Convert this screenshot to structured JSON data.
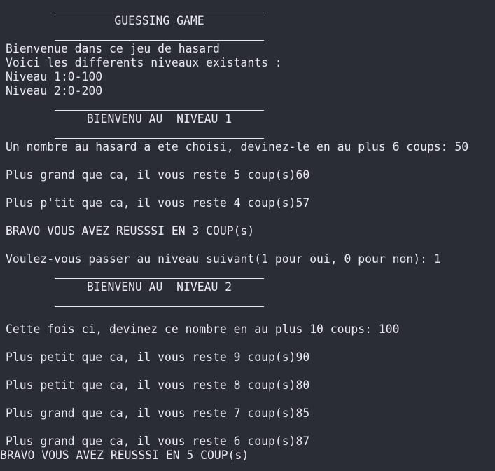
{
  "terminal": {
    "header": {
      "title": "GUESSING GAME"
    },
    "intro": [
      "Bienvenue dans ce jeu de hasard",
      "Voici les differents niveaux existants :",
      "Niveau 1:0-100",
      "Niveau 2:0-200"
    ],
    "level1": {
      "title": "BIENVENU AU  NIVEAU 1",
      "lines": [
        "Un nombre au hasard a ete choisi, devinez-le en au plus 6 coups: 50",
        "Plus grand que ca, il vous reste 5 coup(s)60",
        "Plus p'tit que ca, il vous reste 4 coup(s)57",
        "BRAVO VOUS AVEZ REUSSSI EN 3 COUP(s)",
        "Voulez-vous passer au niveau suivant(1 pour oui, 0 pour non): 1"
      ]
    },
    "level2": {
      "title": "BIENVENU AU  NIVEAU 2",
      "lines": [
        "Cette fois ci, devinez ce nombre en au plus 10 coups: 100",
        "Plus petit que ca, il vous reste 9 coup(s)90",
        "Plus petit que ca, il vous reste 8 coup(s)80",
        "Plus grand que ca, il vous reste 7 coup(s)85",
        "Plus grand que ca, il vous reste 6 coup(s)87"
      ],
      "final": "BRAVO VOUS AVEZ REUSSSI EN 5 COUP(s)"
    }
  }
}
